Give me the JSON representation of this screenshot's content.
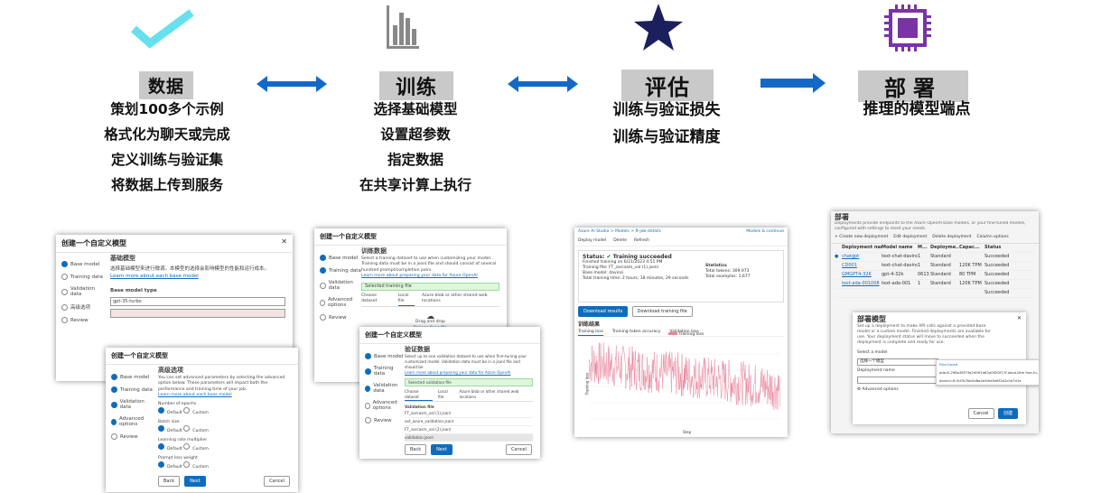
{
  "stages": [
    {
      "title": "数据",
      "icon": "checkmark-icon",
      "lines": [
        "策划100多个示例",
        "格式化为聊天或完成",
        "定义训练与验证集",
        "将数据上传到服务"
      ]
    },
    {
      "title": "训练",
      "icon": "bar-chart-icon",
      "lines": [
        "选择基础模型",
        "设置超参数",
        "指定数据",
        "在共享计算上执行"
      ]
    },
    {
      "title": "评估",
      "icon": "star-icon",
      "lines": [
        "训练与验证损失",
        "训练与验证精度"
      ]
    },
    {
      "title": "部署",
      "icon": "chip-icon",
      "lines": [
        "推理的模型端点"
      ]
    }
  ],
  "colors": {
    "check": "#66e0ee",
    "bars": "#888888",
    "star": "#1b1f5e",
    "chip": "#7a33a6",
    "arrow": "#1469c8",
    "title_bg": "#c9c9c9"
  },
  "shots": {
    "wizard1": {
      "title": "创建一个自定义模型",
      "steps": [
        "Base model",
        "Training data",
        "Validation data",
        "高级选项",
        "Review"
      ],
      "heading": "基础模型",
      "desc": "选择基础模型来进行微调。本模型的选择会影响模型的性能和运行成本。",
      "link": "Learn more about each base model",
      "field_label": "Base model type",
      "field_value": "gpt-35-turbo"
    },
    "wizard2": {
      "title": "创建一个自定义模型",
      "steps": [
        "Base model",
        "Training data",
        "Validation data",
        "Advanced options",
        "Review"
      ],
      "heading": "高级选项",
      "desc": "You can set advanced parameters by selecting the advanced option below. These parameters will impact both the performance and training time of your job.",
      "link": "Learn more about each base model",
      "options": [
        "Number of epochs",
        "Batch size",
        "Learning rate multiplier",
        "Prompt loss weight"
      ],
      "radio_default": "Default",
      "radio_custom": "Custom",
      "back": "Back",
      "next": "Next",
      "cancel": "Cancel"
    },
    "wizard3": {
      "title": "创建一个自定义模型",
      "steps": [
        "Base model",
        "Training data",
        "Validation data",
        "Advanced options",
        "Review"
      ],
      "heading": "训练数据",
      "desc": "Select a training dataset to use when customizing your model. Training data must be in a jsonl file and should consist of several hundred prompt/completion pairs.",
      "link": "Learn more about preparing your data for Azure OpenAI",
      "selected": "Selected training file",
      "tabs": [
        "Choose dataset",
        "Local file",
        "Azure blob or other shared web locations"
      ],
      "drop": "Drag and drop",
      "browse": "Browse for a file"
    },
    "wizard4": {
      "title": "创建一个自定义模型",
      "steps": [
        "Base model",
        "Training data",
        "Validation data",
        "Advanced options",
        "Review"
      ],
      "heading": "验证数据",
      "desc": "Select up to one validation dataset to use when fine-tuning your customized model. Validation data must be in a jsonl file and should be",
      "link": "Learn more about preparing your data for Azure OpenAI",
      "selected": "Selected validation file",
      "tabs": [
        "Choose dataset",
        "Local file",
        "Azure blob or other shared web locations"
      ],
      "list_header": "Validation file",
      "files": [
        "FT_sarcasm_val (1).jsonl",
        "ext_azure_validation.jsonl",
        "FT_sarcasm_val (2).jsonl",
        "validation.jsonl"
      ],
      "back": "Back",
      "next": "Next",
      "cancel": "Cancel"
    },
    "status": {
      "crumb": "Azure AI Studio > Models > ft-job-details",
      "help": "Models & continue",
      "toolbar": [
        "Deploy model",
        "Delete",
        "Refresh"
      ],
      "status_label": "Status: ",
      "status_value": "Training succeeded",
      "lines": [
        "Finished training on 6/21/2023 4:51 PM",
        "Training file: FT_sarcasm_val (1).jsonl",
        "Base model: davinci",
        "Total training time: 2 hours, 18 minutes, 29 seconds"
      ],
      "stats_label": "Statistics",
      "stats": [
        "Total tokens: 309,973",
        "Total examples: 1,677"
      ],
      "btn1": "Download results",
      "btn2": "Download training file",
      "chart_title": "训练结果",
      "chart_tabs": [
        "Training loss",
        "Training token accuracy",
        "Validation loss"
      ],
      "legend": "Training loss",
      "xlabel": "Step",
      "ylabel": "Training loss"
    },
    "deploy": {
      "title": "部署",
      "desc": "Deployments provide endpoints to the Azure OpenAI base models, or your fine-tuned models, configured with settings to meet your needs.",
      "toolbar": [
        "Create new deployment",
        "Edit deployment",
        "Delete deployment",
        "Column options"
      ],
      "cols": [
        "Deployment name",
        "Model name",
        "M...",
        "Deployme...",
        "Capac...",
        "Status"
      ],
      "rows": [
        [
          "chatgpt",
          "text-chat-davinci (002)",
          "1",
          "Standard",
          "",
          "Succeeded"
        ],
        [
          "CD001",
          "text-chat-davinci (002)",
          "1",
          "Standard",
          "120K TPM",
          "Succeeded"
        ],
        [
          "GMGPT4-32K",
          "gpt-4-32k",
          "0613",
          "Standard",
          "80 TPM",
          "Succeeded"
        ],
        [
          "test-ada-001008",
          "text-ada-001",
          "1",
          "Standard",
          "120K TPM",
          "Succeeded"
        ],
        [
          "",
          "",
          "",
          "",
          "",
          "Succeeded"
        ]
      ],
      "dialog_title": "部署模型",
      "dialog_desc": "Set up a deployment to make API calls against a provided base model or a custom model. Finished deployments are available for use. Your deployment status will move to succeeded when the deployment is complete and ready for use.",
      "select_label": "Select a model",
      "select_value": "选择一个模型",
      "dep_label": "Deployment name",
      "adv": "Advanced options",
      "dropdown_head": "Fine-tuned",
      "dropdown_items": [
        "ada.ft-298a3637fa2f49f1d62a0f5f2f17f-abcd-tthe fine-tu...",
        "davinci.ft-5d7b7bb3d8a4e4fea5e8f1b2c0a7d1e"
      ],
      "cancel": "Cancel",
      "create": "创建"
    }
  }
}
